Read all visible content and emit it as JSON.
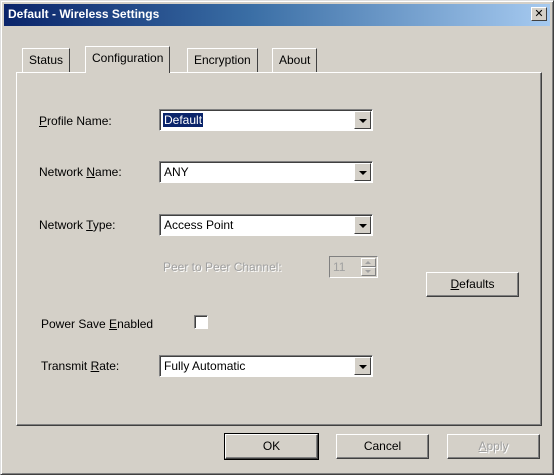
{
  "window": {
    "title": "Default - Wireless Settings",
    "close_glyph": "✕"
  },
  "tabs": [
    {
      "label": "Status"
    },
    {
      "label": "Configuration",
      "active": true
    },
    {
      "label": "Encryption"
    },
    {
      "label": "About"
    }
  ],
  "form": {
    "profile_name": {
      "label_pre": "",
      "label_key": "P",
      "label_post": "rofile Name:",
      "value": "Default"
    },
    "network_name": {
      "label_pre": "Network ",
      "label_key": "N",
      "label_post": "ame:",
      "value": "ANY"
    },
    "network_type": {
      "label_pre": "Network ",
      "label_key": "T",
      "label_post": "ype:",
      "value": "Access Point"
    },
    "peer_channel": {
      "label": "Peer to Peer Channel:",
      "value": "11"
    },
    "power_save": {
      "label_pre": "Power Save ",
      "label_key": "E",
      "label_post": "nabled",
      "checked": false
    },
    "transmit_rate": {
      "label_pre": "Transmit ",
      "label_key": "R",
      "label_post": "ate:",
      "value": "Fully Automatic"
    }
  },
  "buttons": {
    "defaults": {
      "label_key": "D",
      "label_post": "efaults"
    },
    "ok": "OK",
    "cancel": "Cancel",
    "apply": {
      "label_key": "A",
      "label_post": "pply"
    }
  },
  "colors": {
    "titlebar_start": "#0a246a",
    "titlebar_end": "#a6caf0",
    "face": "#d4d0c8",
    "selection": "#0a246a"
  }
}
